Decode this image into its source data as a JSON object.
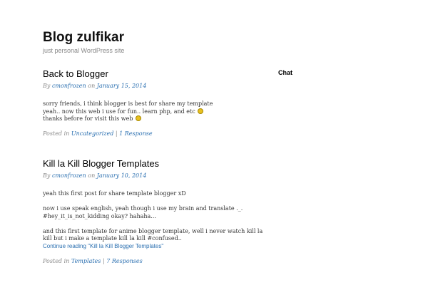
{
  "site": {
    "title": "Blog zulfikar",
    "description": "just personal WordPress site"
  },
  "sidebar": {
    "widget_title": "Chat"
  },
  "posts": [
    {
      "title": "Back to Blogger",
      "by_label": "By",
      "author": "cmonfrozen",
      "on_label": "on",
      "date": "January 15, 2014",
      "lines": [
        "sorry friends, i think blogger is best for share my template",
        "yeah.. now this web i use for fun.. learn php, and etc",
        "thanks before for visit this web"
      ],
      "posted_in_label": "Posted in",
      "category": "Uncategorized",
      "separator": "|",
      "responses": "1 Response"
    },
    {
      "title": "Kill la Kill Blogger Templates",
      "by_label": "By",
      "author": "cmonfrozen",
      "on_label": "on",
      "date": "January 10, 2014",
      "lines": [
        "yeah this first post for share template blogger xD",
        "now i use speak english, yeah though i use my brain and translate ._.",
        "#hey_it_is_not_kidding okay? hahaha...",
        "and this first template for anime blogger template, well i never watch kill la",
        "kill but i make a template kill la kill #confused.."
      ],
      "continue": "Continue reading \"Kill la Kill Blogger Templates\"",
      "posted_in_label": "Posted in",
      "category": "Templates",
      "separator": "|",
      "responses": "7 Responses"
    }
  ],
  "colors": {
    "link": "#2a6fb0",
    "meta": "#888888",
    "smiley": "#e8c020"
  },
  "icons": [
    "smiley-icon"
  ]
}
